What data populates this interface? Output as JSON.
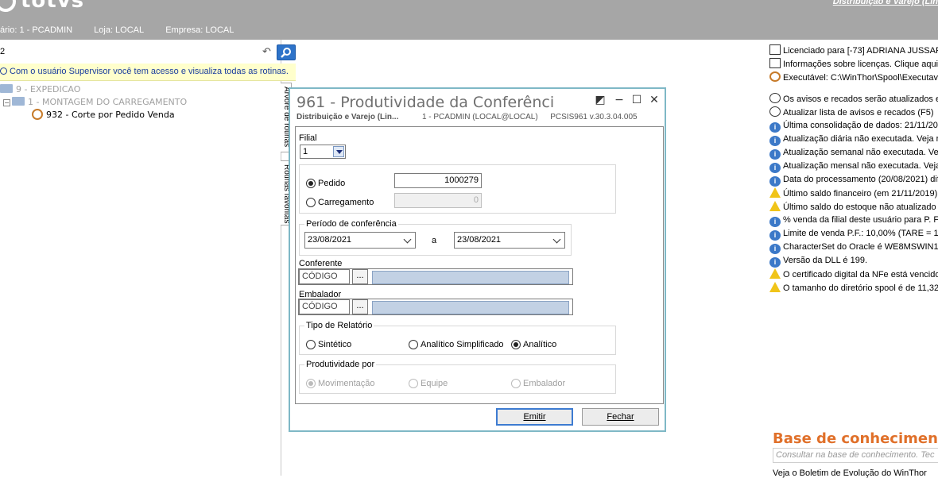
{
  "header": {
    "logo": "totvs",
    "brand_link": "Distribuição e Varejo (Lin",
    "usuario": "ário: 1 - PCADMIN",
    "loja": "Loja: LOCAL",
    "empresa": "Empresa: LOCAL"
  },
  "search": {
    "value": "2",
    "placeholder": ""
  },
  "notice": "Com o usuário Supervisor você tem acesso e visualiza todas as rotinas.",
  "tree": {
    "items": [
      {
        "label": "9 - EXPEDICAO"
      },
      {
        "label": "1 - MONTAGEM DO CARREGAMENTO"
      },
      {
        "label": "932 - Corte por Pedido Venda"
      }
    ]
  },
  "vtabs": {
    "arvore": "Árvore de rotinas",
    "favoritas": "Rotinas favoritas"
  },
  "right": {
    "lines": [
      {
        "icon": "license-icon",
        "text": "Licenciado para [-73] ADRIANA JUSSAR"
      },
      {
        "icon": "license-icon",
        "text": "Informações sobre licenças. Clique aqui p"
      },
      {
        "icon": "executable-icon",
        "text": "Executável: C:\\WinThor\\Spool\\Executav"
      },
      {
        "icon": "",
        "text": ""
      },
      {
        "icon": "clock-icon",
        "text": "Os avisos e recados serão atualizados en"
      },
      {
        "icon": "refresh-icon",
        "text": "Atualizar lista de avisos e recados (F5)"
      },
      {
        "icon": "info-icon",
        "text": "Última consolidação de dados: 21/11/20"
      },
      {
        "icon": "info-icon",
        "text": "Atualização diária não executada. Veja ro"
      },
      {
        "icon": "info-icon",
        "text": "Atualização semanal não executada. Veja"
      },
      {
        "icon": "info-icon",
        "text": "Atualização mensal não executada. Veja"
      },
      {
        "icon": "info-icon",
        "text": "Data do processamento (20/08/2021) dif"
      },
      {
        "icon": "warning-icon",
        "text": "Último saldo financeiro (em 21/11/2019) r"
      },
      {
        "icon": "warning-icon",
        "text": "Último saldo do estoque não atualizado (f"
      },
      {
        "icon": "info-icon",
        "text": "% venda da filial deste usuário para P. F.:"
      },
      {
        "icon": "info-icon",
        "text": "Limite de venda P.F.: 10,00% (TARE = 10"
      },
      {
        "icon": "info-icon",
        "text": "CharacterSet do Oracle é WE8MSWIN12"
      },
      {
        "icon": "info-icon",
        "text": "Versão da DLL é 199."
      },
      {
        "icon": "warning-icon",
        "text": "O certificado digital da NFe está vencido."
      },
      {
        "icon": "warning-icon",
        "text": "O tamanho do diretório spool é de 11,32 G"
      }
    ],
    "kb_title": "Base de conhecimento",
    "kb_placeholder": "Consultar na base de conhecimento. Tec",
    "kb_footer": "Veja o Boletim de Evolução do WinThor"
  },
  "dialog": {
    "title": "961 - Produtividade da Conferência",
    "sub_company": "Distribuição e Varejo (Lin...",
    "sub_user": "1 - PCADMIN (LOCAL@LOCAL)",
    "sub_version": "PCSIS961  v.30.3.04.005",
    "filial_label": "Filial",
    "filial_value": "1",
    "pedido_label": "Pedido",
    "pedido_value": "1000279",
    "carregamento_label": "Carregamento",
    "carregamento_value": "0",
    "periodo_title": "Período de conferência",
    "date_from": "23/08/2021",
    "date_sep": "a",
    "date_to": "23/08/2021",
    "conferente_label": "Conferente",
    "conferente_code": "CÓDIGO",
    "embalador_label": "Embalador",
    "embalador_code": "CÓDIGO",
    "dots": "...",
    "tipo_title": "Tipo de Relatório",
    "tipo_options": [
      "Sintético",
      "Analítico Simplificado",
      "Analítico"
    ],
    "tipo_selected": "Analítico",
    "prod_title": "Produtividade por",
    "prod_options": [
      "Movimentação",
      "Equipe",
      "Embalador"
    ],
    "prod_selected": "Movimentação",
    "emitir": "Emitir",
    "fechar": "Fechar"
  }
}
